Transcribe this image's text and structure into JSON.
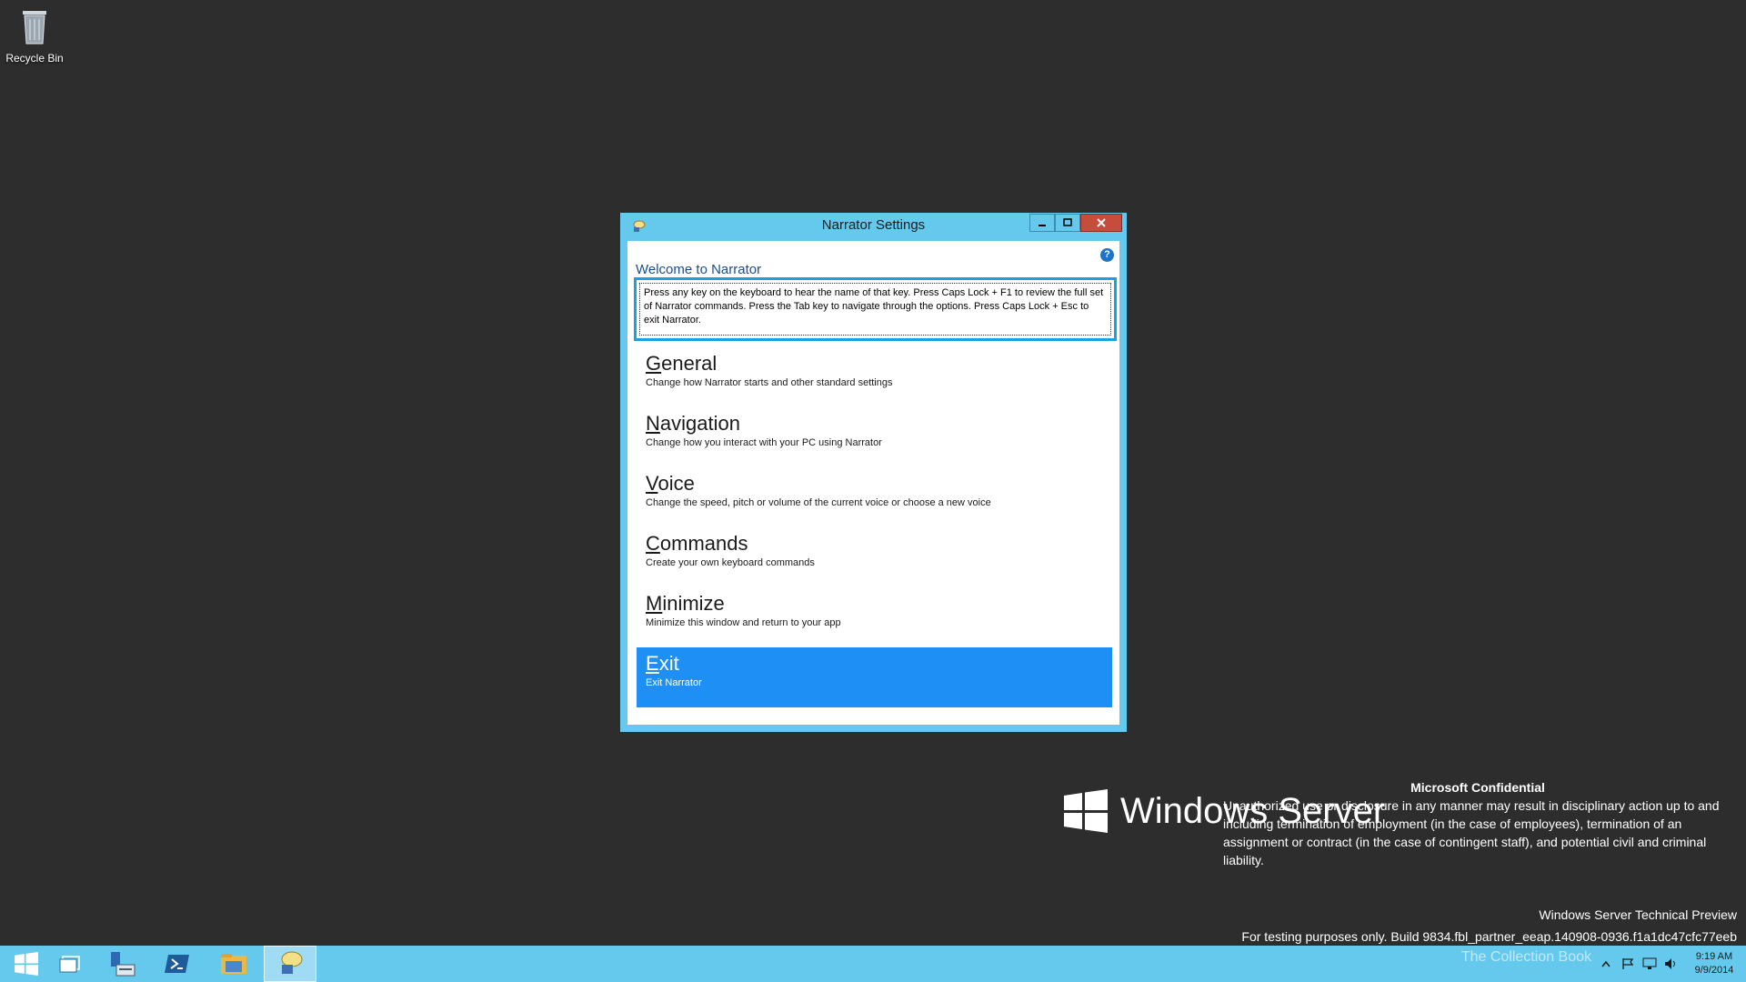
{
  "desktop": {
    "icons": [
      {
        "label": "Recycle Bin",
        "icon": "recycle-bin-icon"
      }
    ]
  },
  "window": {
    "title": "Narrator Settings",
    "welcome": "Welcome to Narrator",
    "intro": "Press any key on the keyboard to hear the name of that key.  Press Caps Lock + F1 to review the full set of Narrator commands.  Press the Tab key to navigate through the options.  Press Caps Lock + Esc to exit Narrator.",
    "help_glyph": "?",
    "menu": [
      {
        "accel": "G",
        "rest": "eneral",
        "desc": "Change how Narrator starts and other standard settings"
      },
      {
        "accel": "N",
        "rest": "avigation",
        "desc": "Change how you interact with your PC using Narrator"
      },
      {
        "accel": "V",
        "rest": "oice",
        "desc": "Change the speed, pitch or volume of the current voice or choose a new voice"
      },
      {
        "accel": "C",
        "rest": "ommands",
        "desc": "Create your own keyboard commands"
      },
      {
        "accel": "M",
        "rest": "inimize",
        "desc": "Minimize this window and return to your app"
      },
      {
        "accel": "E",
        "rest": "xit",
        "desc": "Exit Narrator",
        "selected": true
      }
    ]
  },
  "branding": {
    "product": "Windows Server",
    "confidential_title": "Microsoft Confidential",
    "confidential_text": "Unauthorized use or disclosure in any manner may result in disciplinary action up to and including termination of employment (in the case of employees), termination of an assignment or contract (in the case of contingent staff), and potential civil and criminal liability.",
    "edition": "Windows Server Technical Preview",
    "build": "For testing purposes only. Build 9834.fbl_partner_eeap.140908-0936.f1a1dc47cfc77eeb"
  },
  "taskbar": {
    "watermark": "The Collection Book",
    "clock_time": "9:19 AM",
    "clock_date": "9/9/2014"
  },
  "colors": {
    "accent": "#65c9ee",
    "selection": "#1e90f5",
    "close": "#c74c3c"
  }
}
